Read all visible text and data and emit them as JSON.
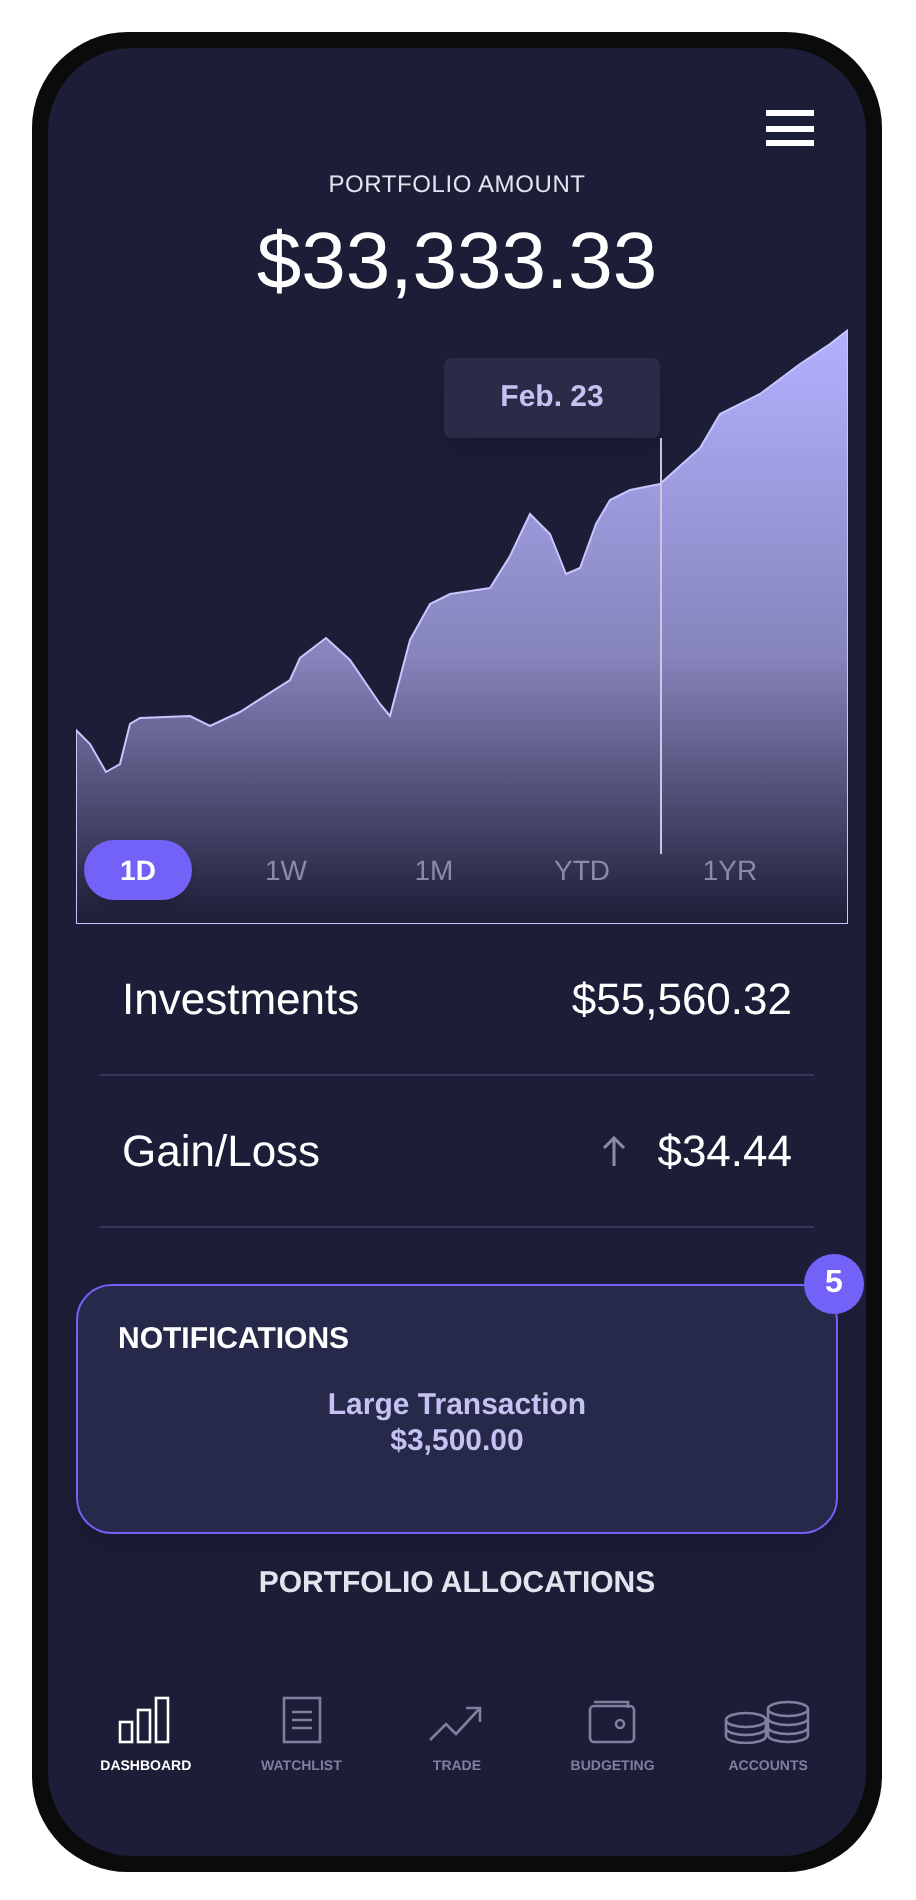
{
  "header": {
    "label": "PORTFOLIO AMOUNT",
    "amount": "$33,333.33"
  },
  "chart": {
    "tooltip": "Feb. 23"
  },
  "ranges": [
    {
      "label": "1D",
      "selected": true
    },
    {
      "label": "1W",
      "selected": false
    },
    {
      "label": "1M",
      "selected": false
    },
    {
      "label": "YTD",
      "selected": false
    },
    {
      "label": "1YR",
      "selected": false
    }
  ],
  "summary": [
    {
      "kind": "plain",
      "label": "Investments",
      "value": "$55,560.32"
    },
    {
      "kind": "gain",
      "label": "Gain/Loss",
      "value": "$34.44"
    }
  ],
  "notifications": {
    "title": "NOTIFICATIONS",
    "count": "5",
    "item_title": "Large Transaction",
    "item_amount": "$3,500.00"
  },
  "allocations_title": "PORTFOLIO ALLOCATIONS",
  "nav": [
    {
      "label": "DASHBOARD",
      "selected": true
    },
    {
      "label": "WATCHLIST",
      "selected": false
    },
    {
      "label": "TRADE",
      "selected": false
    },
    {
      "label": "BUDGETING",
      "selected": false
    },
    {
      "label": "ACCOUNTS",
      "selected": false
    }
  ]
}
